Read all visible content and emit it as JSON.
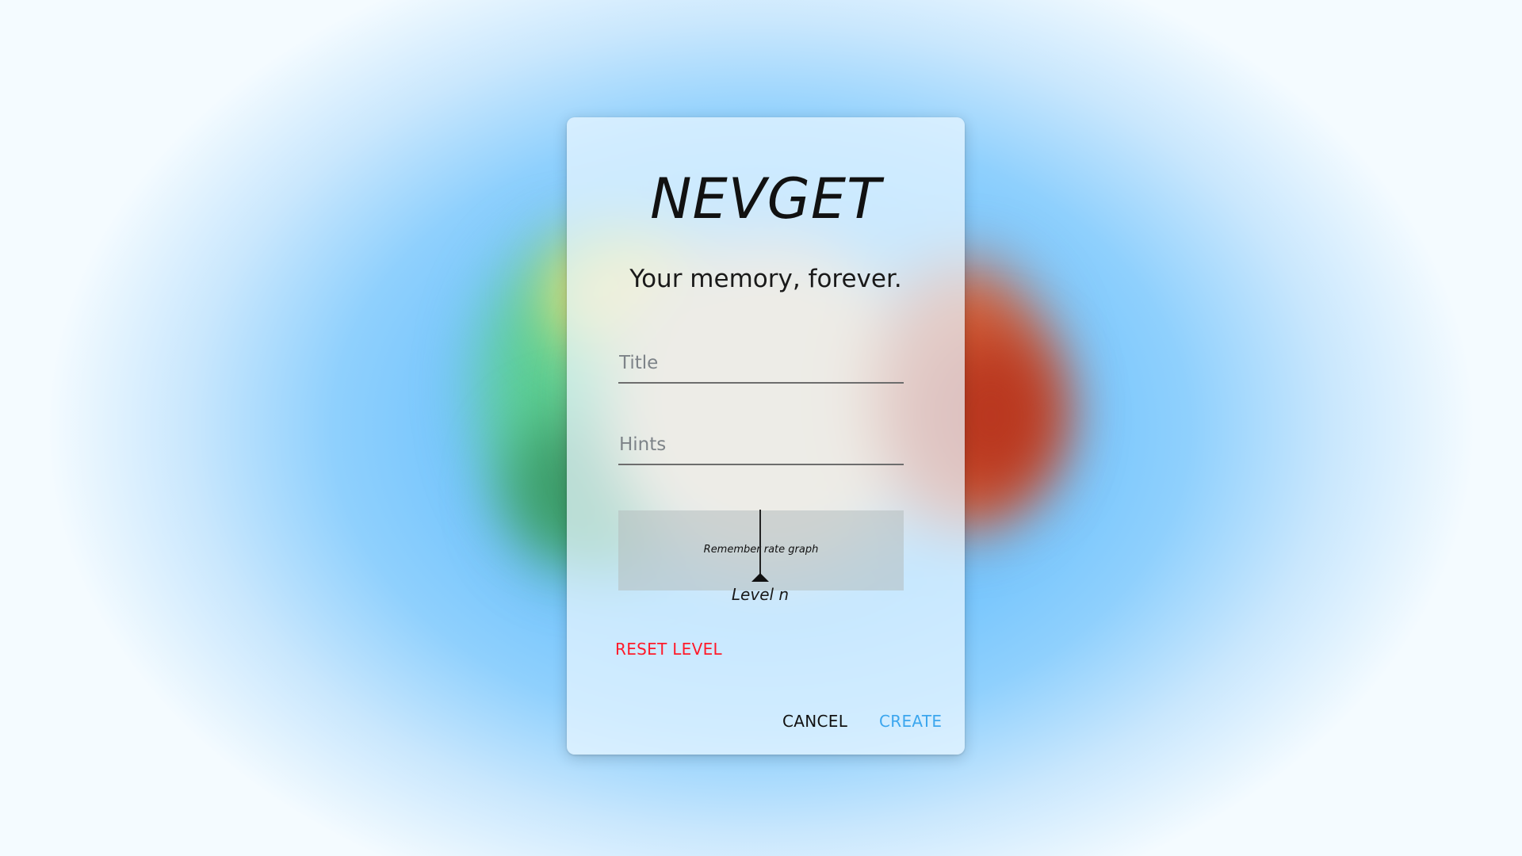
{
  "app": {
    "title": "NEVGET",
    "tagline": "Your memory, forever."
  },
  "form": {
    "title_placeholder": "Title",
    "hints_placeholder": "Hints"
  },
  "graph": {
    "label": "Remember rate graph",
    "level_label": "Level n"
  },
  "buttons": {
    "reset_level": "RESET LEVEL",
    "cancel": "CANCEL",
    "create": "CREATE"
  },
  "colors": {
    "reset": "#ff1a2a",
    "create": "#3ba6ee",
    "cancel": "#111111"
  }
}
